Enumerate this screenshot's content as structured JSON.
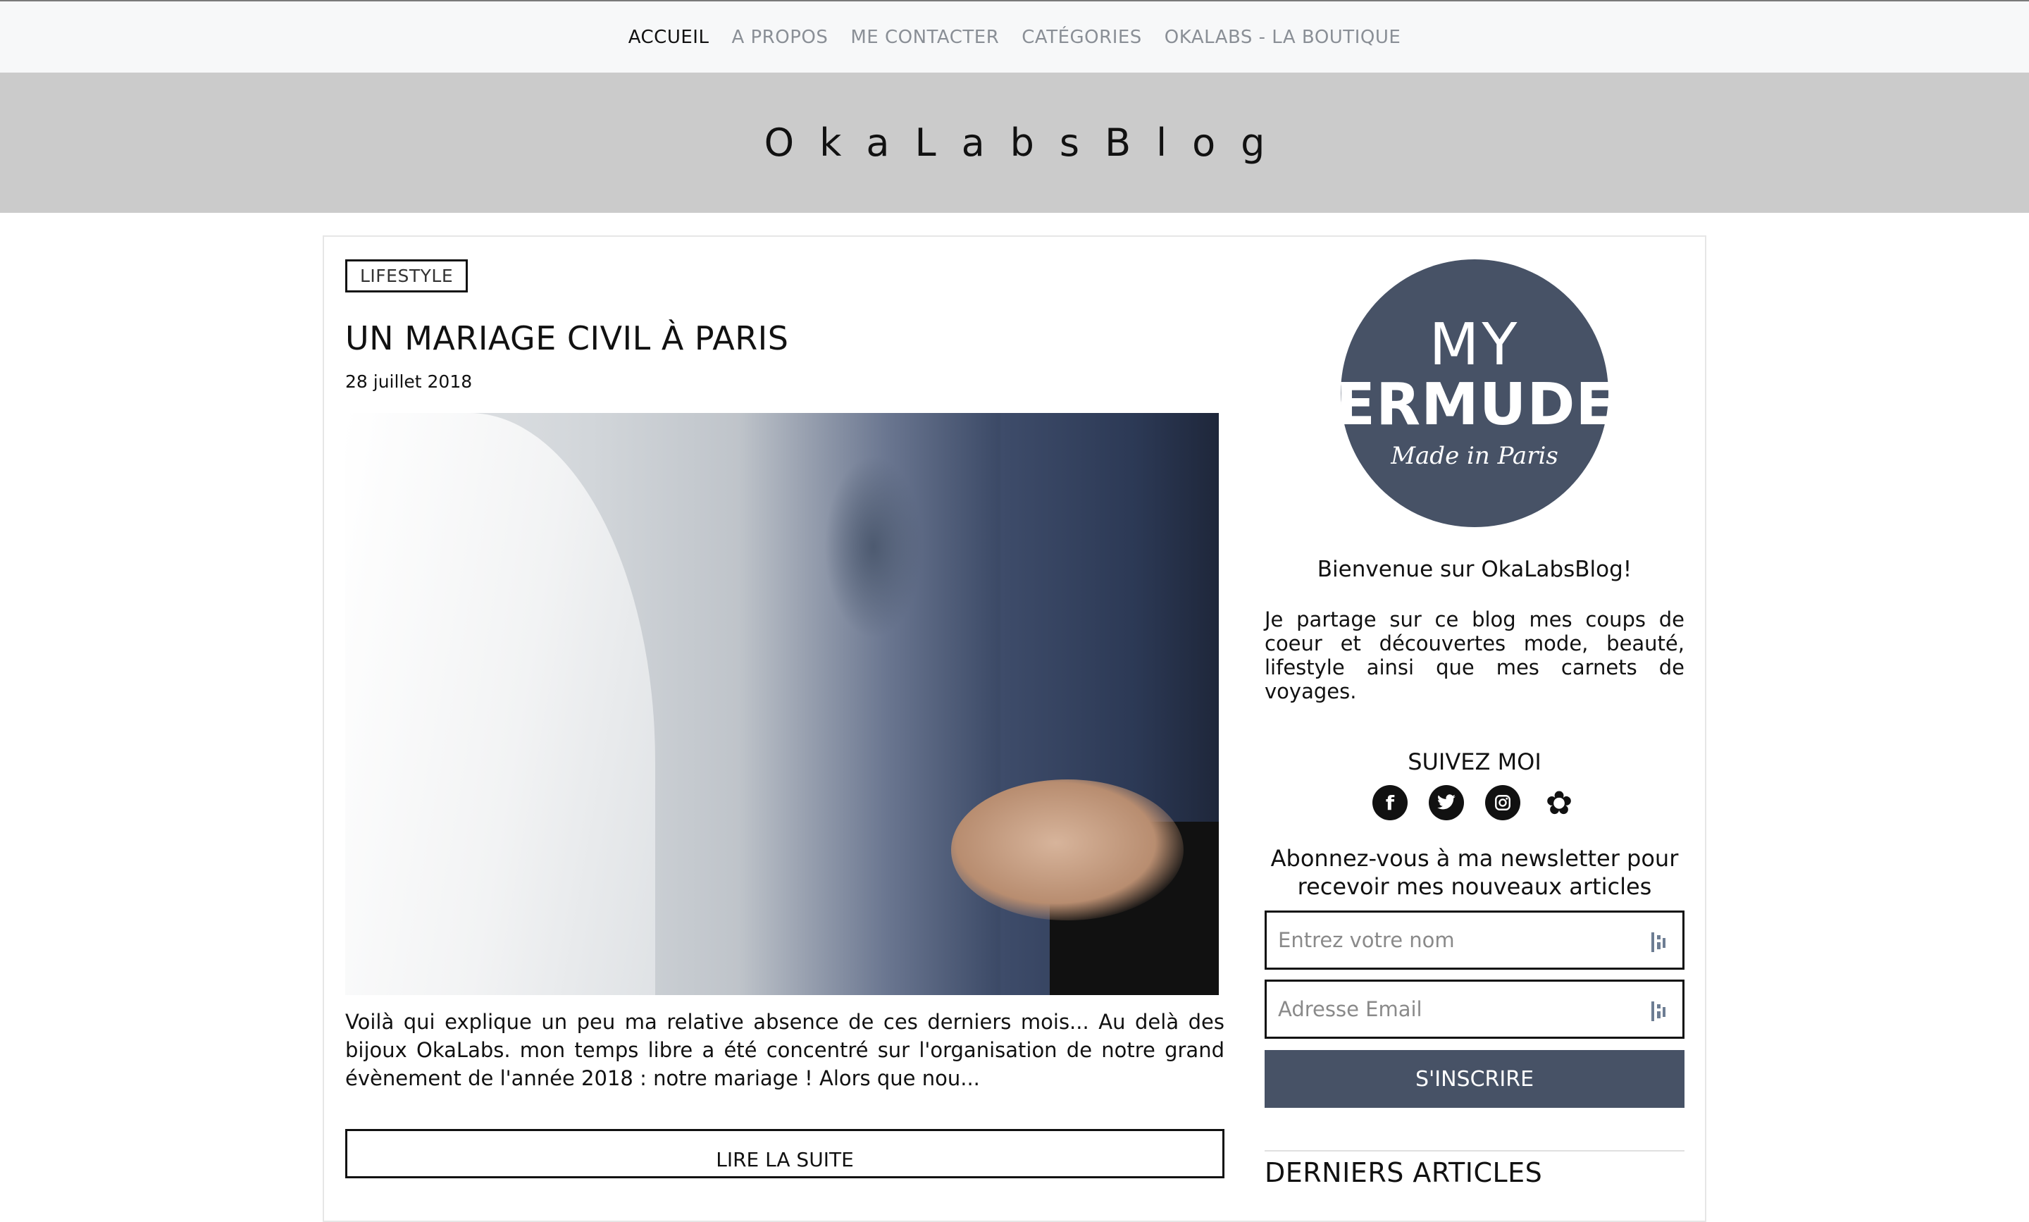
{
  "nav": {
    "items": [
      {
        "label": "ACCUEIL",
        "active": true
      },
      {
        "label": "A PROPOS",
        "active": false
      },
      {
        "label": "ME CONTACTER",
        "active": false
      },
      {
        "label": "CATÉGORIES",
        "active": false
      },
      {
        "label": "OKALABS - LA BOUTIQUE",
        "active": false
      }
    ]
  },
  "hero": {
    "title": "OkaLabsBlog"
  },
  "post": {
    "category": "LIFESTYLE",
    "title": "UN MARIAGE CIVIL À PARIS",
    "date": "28 juillet 2018",
    "excerpt": "Voilà qui explique un peu ma relative absence de ces derniers mois... Au delà des bijoux OkaLabs. mon temps libre a été concentré sur l'organisation de notre grand évènement de l'année 2018 : notre mariage ! Alors que nou...",
    "read_more": "LIRE LA SUITE"
  },
  "sidebar": {
    "logo": {
      "line1": "MY",
      "line2": "BERMUDES",
      "line3": "Made in Paris"
    },
    "welcome": "Bienvenue sur OkaLabsBlog!",
    "intro": "Je partage sur ce blog mes coups de coeur et découvertes mode, beauté, lifestyle ainsi que mes carnets de voyages.",
    "follow_title": "SUIVEZ MOI",
    "socials": [
      {
        "icon": "facebook-icon",
        "glyph": "f"
      },
      {
        "icon": "twitter-icon",
        "glyph": "🐦"
      },
      {
        "icon": "instagram-icon",
        "glyph": "◎"
      },
      {
        "icon": "flower-logo-icon",
        "glyph": "✿"
      }
    ],
    "newsletter_title": "Abonnez-vous à ma newsletter pour recevoir mes nouveaux articles",
    "name_placeholder": "Entrez votre nom",
    "email_placeholder": "Adresse Email",
    "subscribe_label": "S'INSCRIRE",
    "latest_title": "DERNIERS ARTICLES"
  },
  "colors": {
    "accent": "#475266",
    "hero_bg": "#cbcbcb",
    "nav_bg": "#f7f8f9"
  }
}
